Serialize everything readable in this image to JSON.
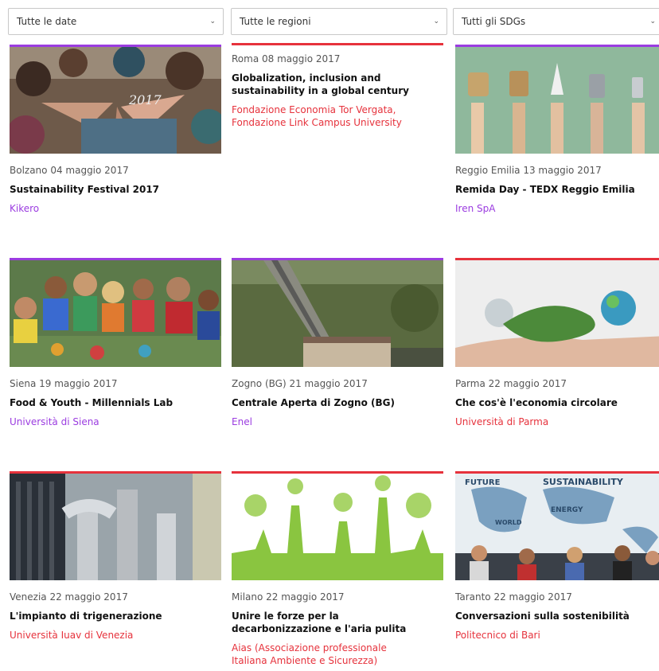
{
  "filters": {
    "dates": "Tutte le date",
    "regions": "Tutte le regioni",
    "sdgs": "Tutti gli SDGs"
  },
  "colors": {
    "purple": "#9b3ce0",
    "red": "#e6323c"
  },
  "events": [
    {
      "meta": "Bolzano 04 maggio 2017",
      "title": "Sustainability Festival 2017",
      "org": "Kikero",
      "accent": "purple",
      "image": "group-hands-photo"
    },
    {
      "meta": "Roma 08 maggio 2017",
      "title": "Globalization, inclusion and sustainability in a global century",
      "org": "Fondazione Economia Tor Vergata, Fondazione Link Campus University",
      "accent": "red",
      "image": ""
    },
    {
      "meta": "Reggio Emilia 13 maggio 2017",
      "title": "Remida Day - TEDX Reggio Emilia",
      "org": "Iren SpA",
      "accent": "purple",
      "image": "hands-recycled-objects-photo"
    },
    {
      "meta": "Siena 19 maggio 2017",
      "title": "Food & Youth - Millennials Lab",
      "org": "Università di Siena",
      "accent": "purple",
      "image": "young-people-group-photo"
    },
    {
      "meta": "Zogno (BG) 21 maggio 2017",
      "title": "Centrale Aperta di Zogno (BG)",
      "org": "Enel",
      "accent": "purple",
      "image": "hydro-plant-photo"
    },
    {
      "meta": "Parma 22 maggio 2017",
      "title": "Che cos'è l'economia circolare",
      "org": "Università di Parma",
      "accent": "red",
      "image": "circular-economy-hand-photo"
    },
    {
      "meta": "Venezia 22 maggio 2017",
      "title": "L'impianto di trigenerazione",
      "org": "Università Iuav di Venezia",
      "accent": "red",
      "image": "industrial-pipes-photo"
    },
    {
      "meta": "Milano 22 maggio 2017",
      "title": "Unire le forze per la decarbonizzazione e l'aria pulita",
      "org": "Aias (Associazione professionale Italiana Ambiente e Sicurezza)",
      "accent": "red",
      "image": "green-factory-illustration"
    },
    {
      "meta": "Taranto 22 maggio 2017",
      "title": "Conversazioni sulla sostenibilità",
      "org": "Politecnico di Bari",
      "accent": "red",
      "image": "sustainability-world-map-photo"
    }
  ],
  "image_texts": {
    "photo_caption_1": "2017",
    "map_words": [
      "FUTURE",
      "SUSTAINABILITY",
      "ENERGY",
      "WORLD"
    ]
  }
}
